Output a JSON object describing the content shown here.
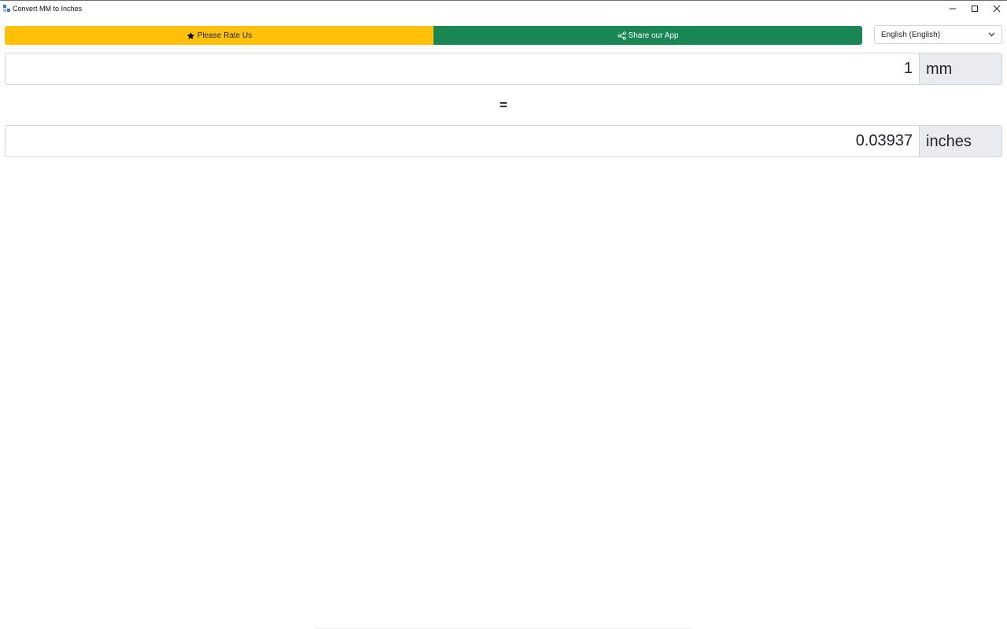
{
  "window": {
    "title": "Convert MM to Inches",
    "icon": "app-icon",
    "controls": [
      "minimize-icon",
      "maximize-icon",
      "close-icon"
    ]
  },
  "toolbar": {
    "rate_label": "Please Rate Us",
    "rate_icon": "star-icon",
    "share_label": "Share our App",
    "share_icon": "share-icon",
    "colors": {
      "rate": "#ffc107",
      "share": "#198754"
    }
  },
  "language": {
    "selected": "English (English)"
  },
  "converter": {
    "input_value": "1",
    "input_unit": "mm",
    "equals": "=",
    "output_value": "0.03937",
    "output_unit": "inches"
  }
}
